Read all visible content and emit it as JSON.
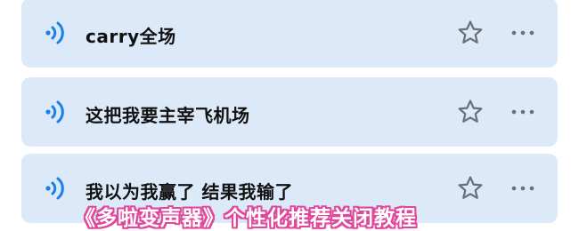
{
  "sound_list": {
    "items": [
      {
        "title": "carry全场"
      },
      {
        "title": "这把我要主宰飞机场"
      },
      {
        "title": "我以为我赢了 结果我输了"
      }
    ]
  },
  "caption": {
    "text": "《多啦变声器》个性化推荐关闭教程"
  },
  "icons": {
    "play": "sound-wave-icon",
    "favorite": "star-outline-icon",
    "more": "more-horizontal-icon"
  },
  "colors": {
    "row_background": "#dbe9f8",
    "accent_blue": "#1a7fe6",
    "caption_outline": "#e0479b"
  }
}
